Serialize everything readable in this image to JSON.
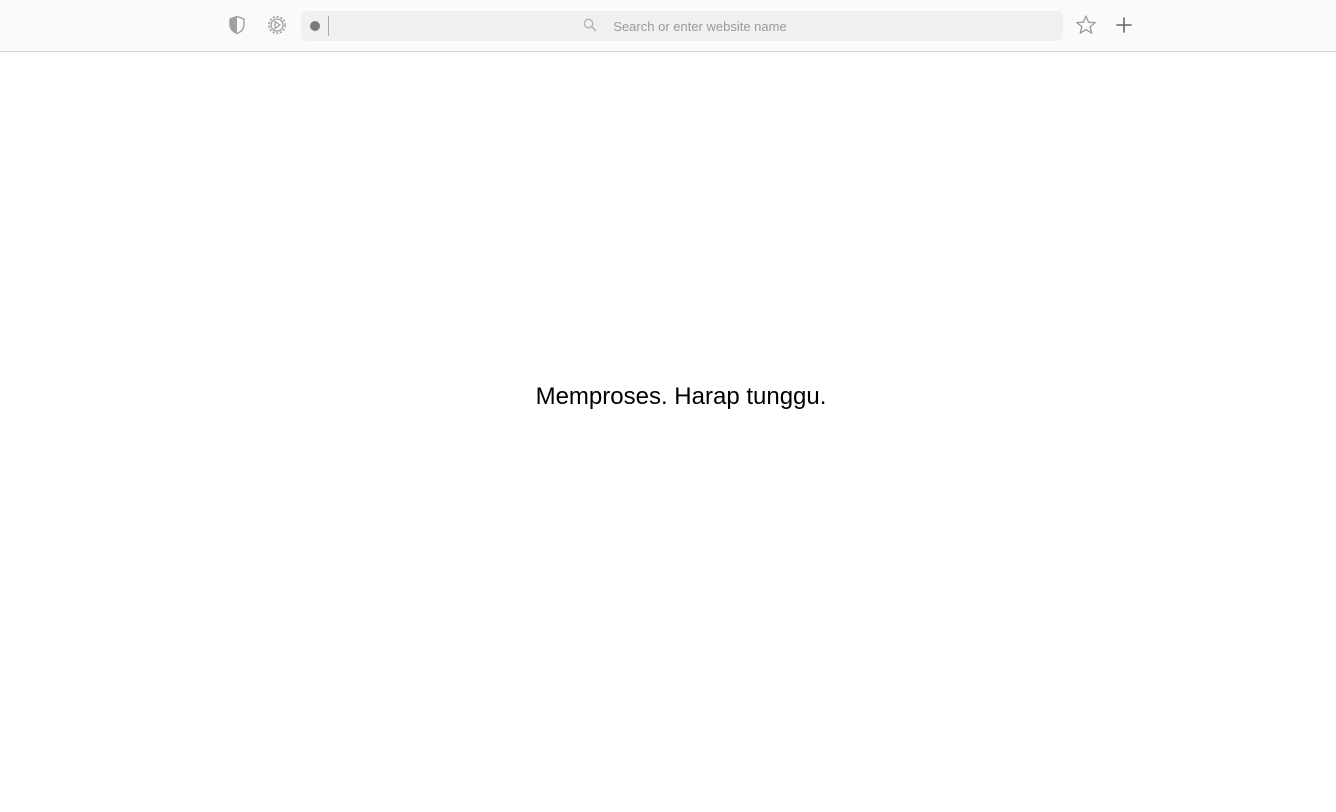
{
  "toolbar": {
    "icons": {
      "privacy": "shield-icon",
      "extensions": "gear-icon",
      "bookmark": "star-icon",
      "new_tab": "plus-icon",
      "search": "search-icon"
    },
    "address_bar": {
      "placeholder": "Search or enter website name",
      "value": ""
    }
  },
  "content": {
    "message": "Memproses. Harap tunggu."
  },
  "colors": {
    "toolbar_bg": "#fafafa",
    "address_bg": "#f0f0f0",
    "icon": "#9a9a9a"
  }
}
